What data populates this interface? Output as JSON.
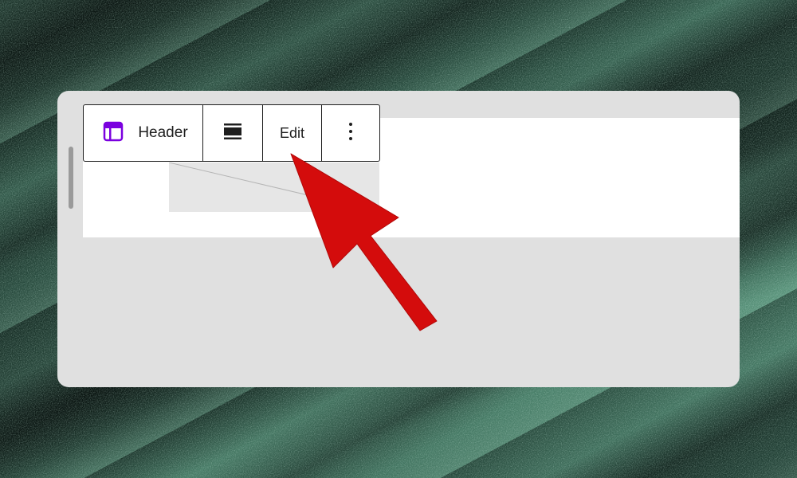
{
  "toolbar": {
    "block_label": "Header",
    "edit_label": "Edit",
    "block_icon": "template-part-icon",
    "align_icon": "align-full-icon",
    "more_icon": "more-vertical-icon"
  },
  "colors": {
    "accent": "#7a00df",
    "arrow": "#d40c0c",
    "panel": "#e0e0e0"
  }
}
